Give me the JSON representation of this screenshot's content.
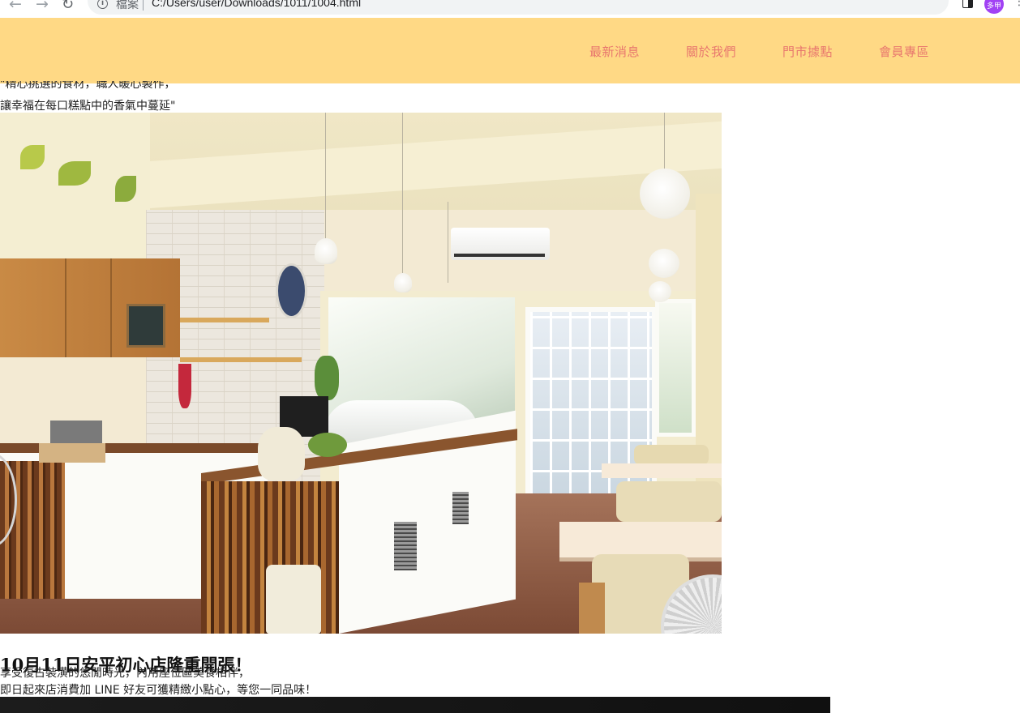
{
  "browser": {
    "scheme_label": "檔案",
    "url": "C:/Users/user/Downloads/1011/1004.html",
    "profile_initials": "多甲",
    "icons": [
      "back-arrow-icon",
      "forward-arrow-icon",
      "reload-icon",
      "info-icon",
      "share-icon",
      "star-icon",
      "side-panel-icon",
      "menu-icon"
    ]
  },
  "header": {
    "background": "#ffd985",
    "link_color": "#e8776e",
    "nav": {
      "latest": "最新消息",
      "about": "關於我們",
      "stores": "門市據點",
      "member": "會員專區"
    }
  },
  "intro": {
    "line1": "\"精心挑選的食材，職人暖心製作，",
    "line2": "讓幸福在每口糕點中的香氣中蔓延\""
  },
  "news": {
    "title": "10月11日安平初心店隆重開張！",
    "line1": "享受復古裝潢的悠閒時光，內用座位區美食相伴，",
    "line2": "即日起來店消費加 LINE 好友可獲精緻小點心，等您一同品味！"
  }
}
